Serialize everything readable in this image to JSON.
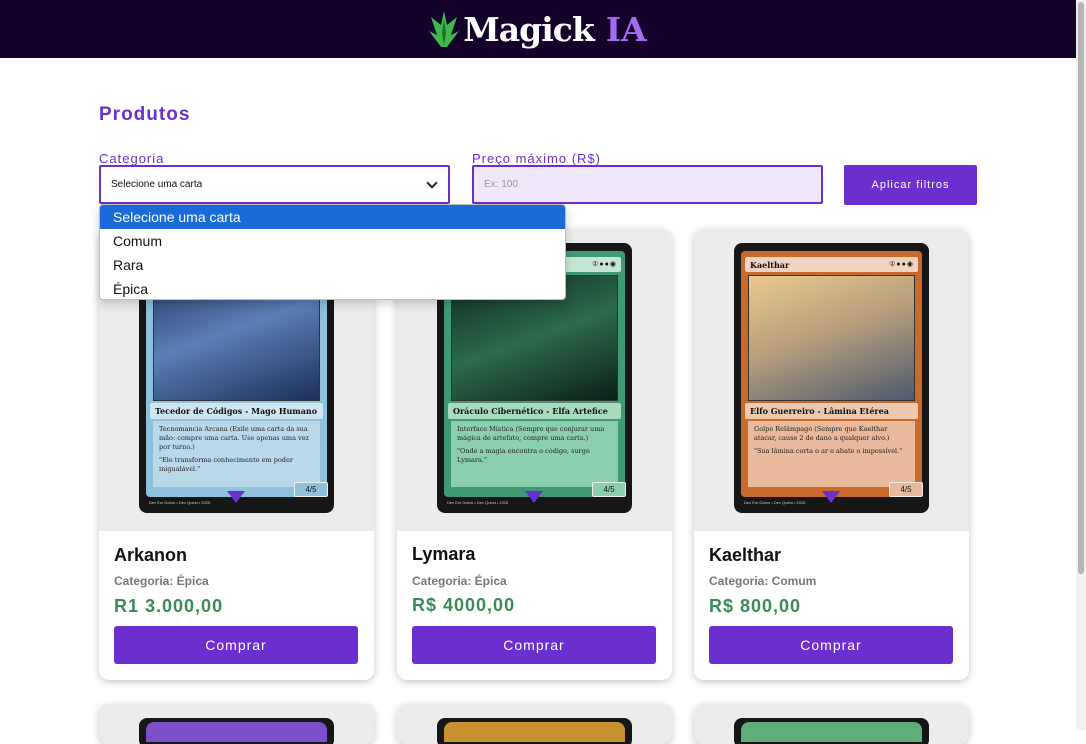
{
  "header": {
    "logo_main": "Magick",
    "logo_accent": "IA",
    "logo_icon": "leaf-crown-icon"
  },
  "page": {
    "title": "Produtos"
  },
  "filters": {
    "category_label": "Categoria",
    "category_value": "Selecione uma carta",
    "price_label": "Preço máximo (R$)",
    "price_placeholder": "Ex: 100",
    "apply_label": "Aplicar filtros",
    "options": [
      "Selecione uma carta",
      "Comum",
      "Rara",
      "Épica"
    ]
  },
  "colors": {
    "accent": "#6b2fd0",
    "header_bg": "#14022b",
    "price": "#3a8a5a",
    "selected_option": "#1a6ad8"
  },
  "products": [
    {
      "name": "Arkanon",
      "category": "Categoria: Épica",
      "price": "R1 3.000,00",
      "buy_label": "Comprar",
      "card_title": "",
      "card_type": "Tecedor de Códigos - Mago Humano",
      "card_rules": "Tecnomancia Arcana (Exile uma carta da sua mão: compre uma carta. Use apenas uma vez por turno.)",
      "card_flavor": "\"Ele transforma conhecimento em poder inigualável.\"",
      "card_pt": "4/5",
      "card_footer": "Dev Em Dobro • Dev Quest • 2025",
      "frame_color": "#8ec2dc"
    },
    {
      "name": "Lymara",
      "category": "Categoria: Épica",
      "price": "R$ 4000,00",
      "buy_label": "Comprar",
      "card_title": "",
      "card_type": "Oráculo Cibernético - Elfa Artefice",
      "card_rules": "Interface Mística (Sempre que conjurar uma mágica de artefato, compre uma carta.)",
      "card_flavor": "\"Onde a magia encontra o código, surge Lymara.\"",
      "card_pt": "4/5",
      "card_footer": "Dev Em Dobro • Dev Quest • 2025",
      "frame_color": "#8ccfae"
    },
    {
      "name": "Kaelthar",
      "category": "Categoria: Comum",
      "price": "R$ 800,00",
      "buy_label": "Comprar",
      "card_title": "Kaelthar",
      "card_type": "Elfo Guerreiro - Lâmina Etérea",
      "card_rules": "Golpe Relâmpago (Sempre que Kaelthar atacar, cause 2 de dano a qualquer alvo.)",
      "card_flavor": "\"Sua lâmina corta o ar e abate o impossível.\"",
      "card_pt": "4/5",
      "card_footer": "Dev Em Dobro • Dev Quest • 2025",
      "frame_color": "#e8b99b"
    }
  ],
  "next_row_colors": [
    "#7a4fc9",
    "#c8902e",
    "#5fae77"
  ]
}
